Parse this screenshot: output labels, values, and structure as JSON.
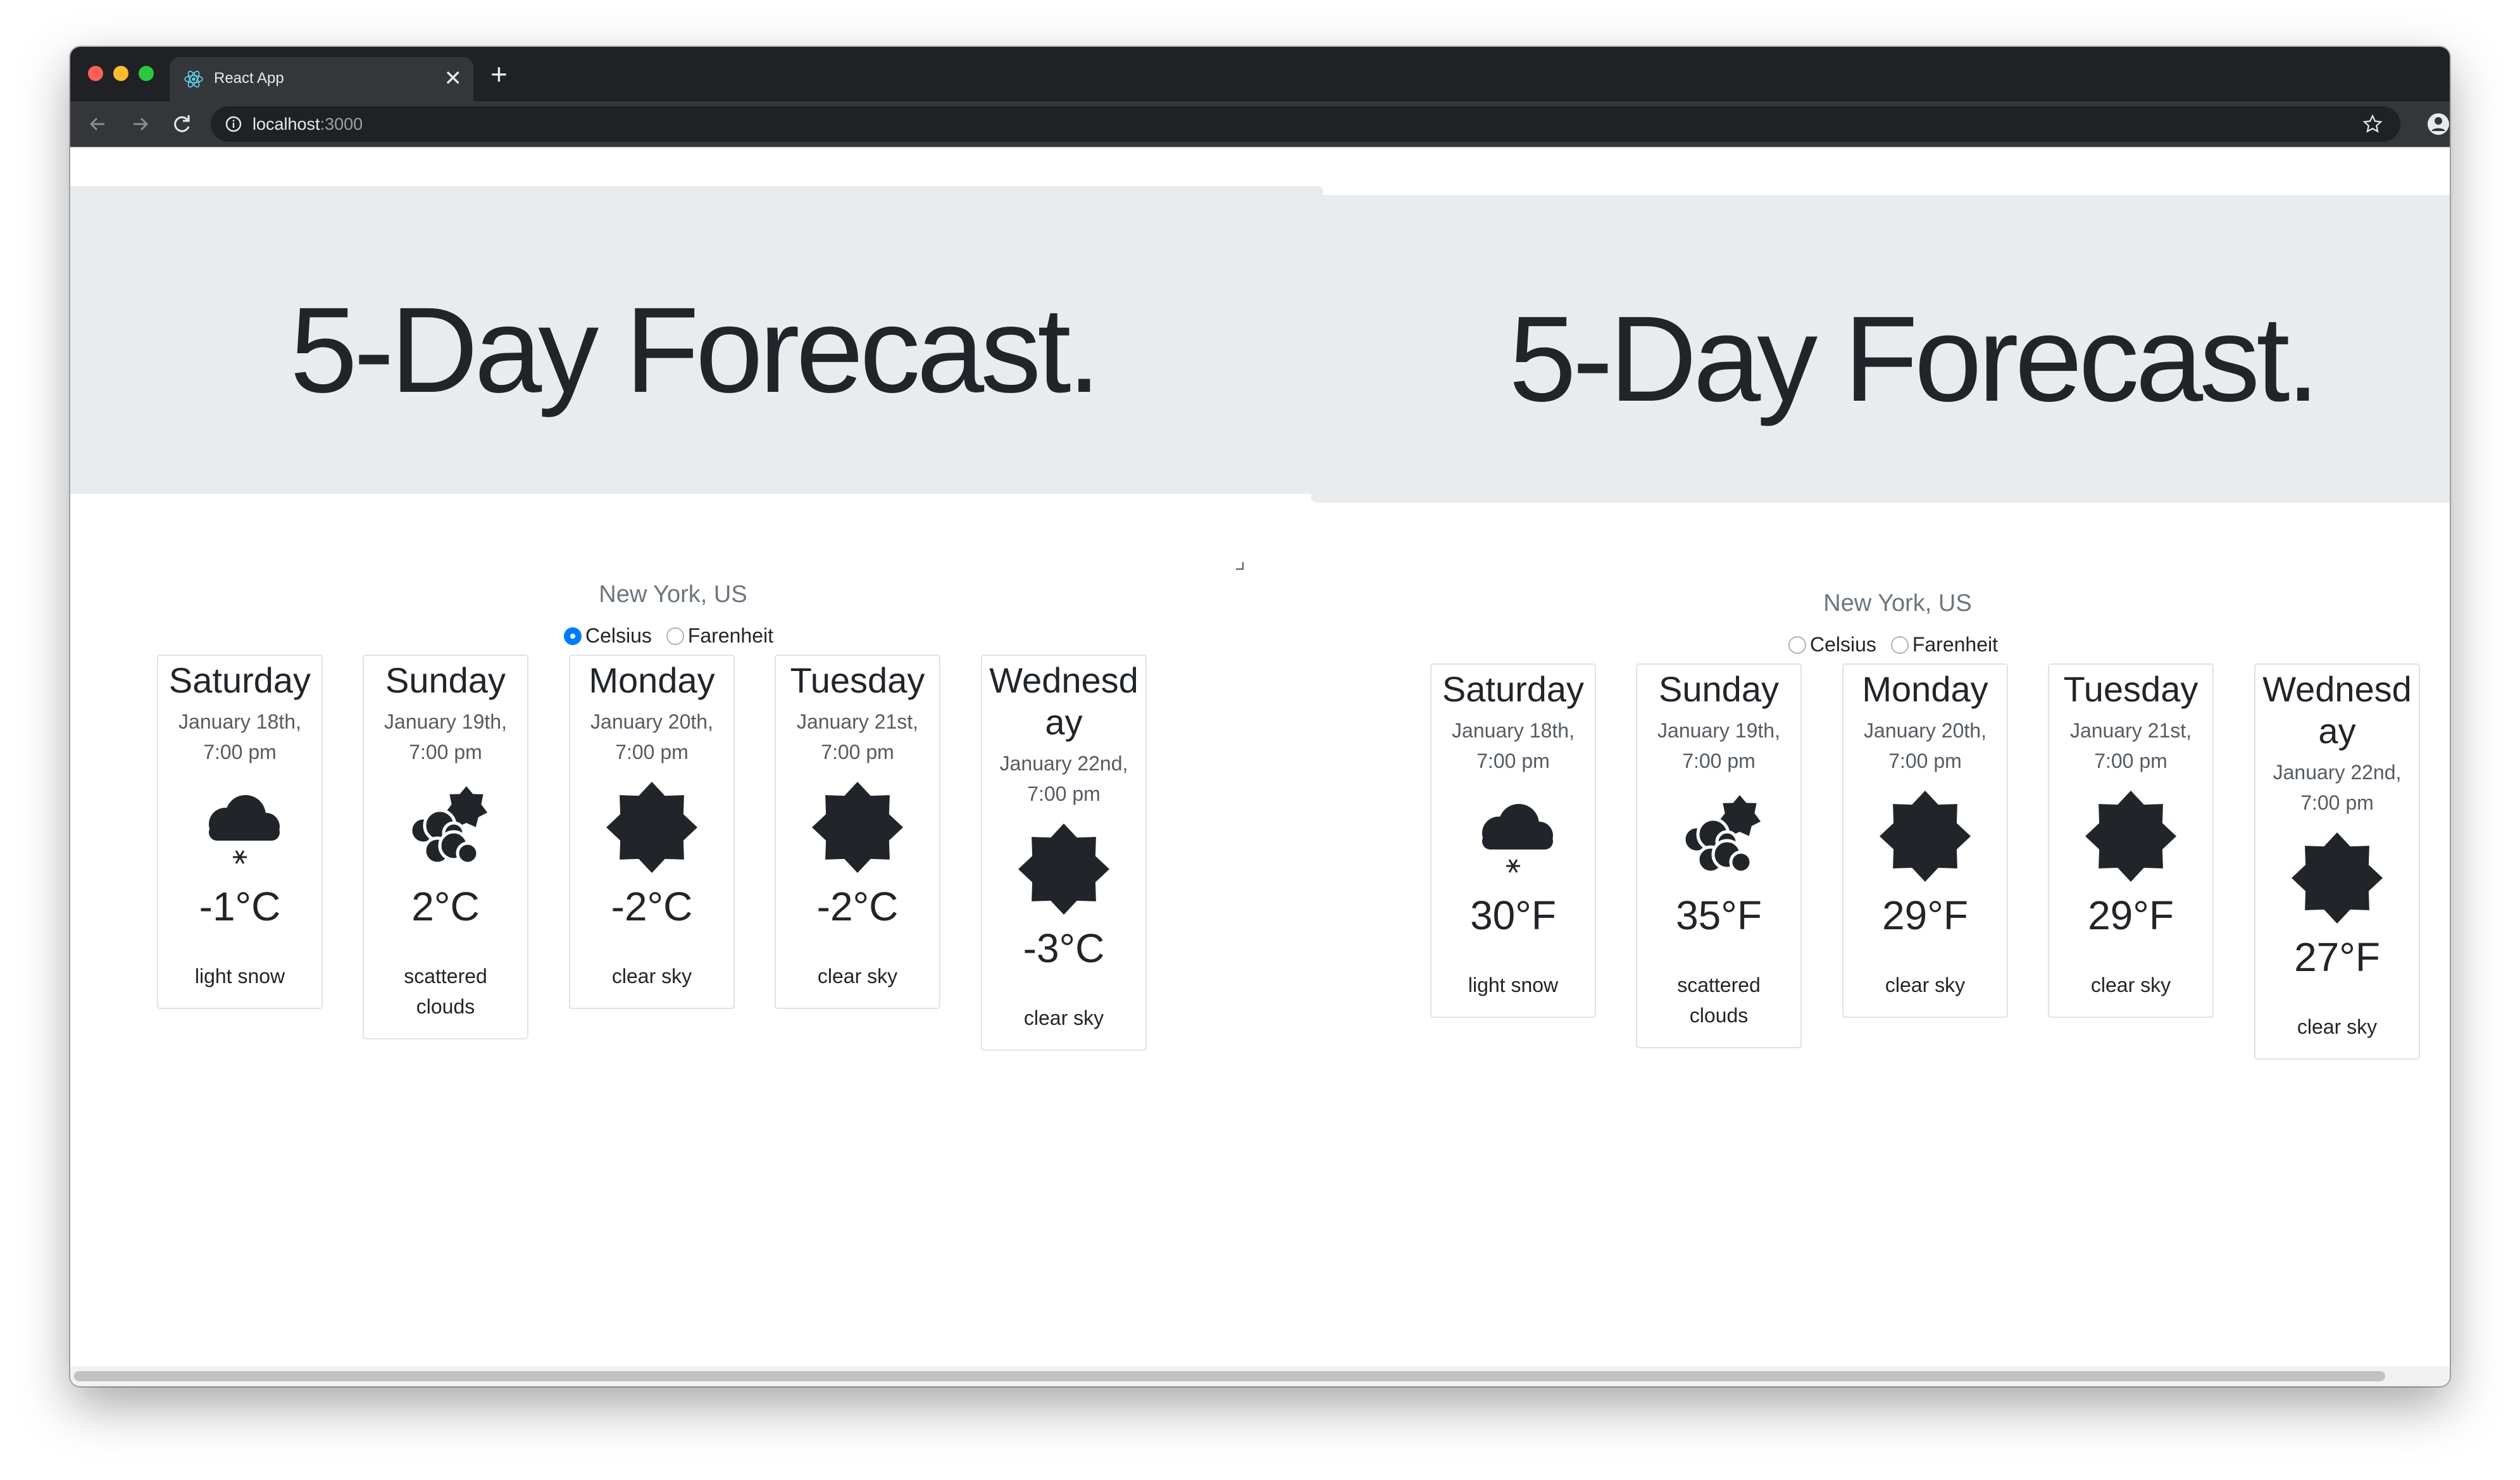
{
  "browser": {
    "tab_title": "React App",
    "url_host": "localhost",
    "url_port": ":3000"
  },
  "left": {
    "title": "5-Day Forecast.",
    "city": "New York, US",
    "units": {
      "celsius": "Celsius",
      "fahrenheit": "Farenheit",
      "selected": "celsius"
    },
    "days": [
      {
        "day": "Saturday",
        "date": "January 18th, 7:00 pm",
        "icon": "snow-cloud-icon",
        "temp": "-1°C",
        "desc": "light snow"
      },
      {
        "day": "Sunday",
        "date": "January 19th, 7:00 pm",
        "icon": "clouds-sun-icon",
        "temp": "2°C",
        "desc": "scattered clouds"
      },
      {
        "day": "Monday",
        "date": "January 20th, 7:00 pm",
        "icon": "sun-icon",
        "temp": "-2°C",
        "desc": "clear sky"
      },
      {
        "day": "Tuesday",
        "date": "January 21st, 7:00 pm",
        "icon": "sun-icon",
        "temp": "-2°C",
        "desc": "clear sky"
      },
      {
        "day": "Wednesday",
        "date": "January 22nd, 7:00 pm",
        "icon": "sun-icon",
        "temp": "-3°C",
        "desc": "clear sky"
      }
    ]
  },
  "right": {
    "title": "5-Day Forecast.",
    "city": "New York, US",
    "units": {
      "celsius": "Celsius",
      "fahrenheit": "Farenheit",
      "selected": "none"
    },
    "days": [
      {
        "day": "Saturday",
        "date": "January 18th, 7:00 pm",
        "icon": "snow-cloud-icon",
        "temp": "30°F",
        "desc": "light snow"
      },
      {
        "day": "Sunday",
        "date": "January 19th, 7:00 pm",
        "icon": "clouds-sun-icon",
        "temp": "35°F",
        "desc": "scattered clouds"
      },
      {
        "day": "Monday",
        "date": "January 20th, 7:00 pm",
        "icon": "sun-icon",
        "temp": "29°F",
        "desc": "clear sky"
      },
      {
        "day": "Tuesday",
        "date": "January 21st, 7:00 pm",
        "icon": "sun-icon",
        "temp": "29°F",
        "desc": "clear sky"
      },
      {
        "day": "Wednesday",
        "date": "January 22nd, 7:00 pm",
        "icon": "sun-icon",
        "temp": "27°F",
        "desc": "clear sky"
      }
    ]
  },
  "colors": {
    "jumbotron": "#e9ecef",
    "radio_checked": "#007bff",
    "chrome_dark": "#202124"
  }
}
